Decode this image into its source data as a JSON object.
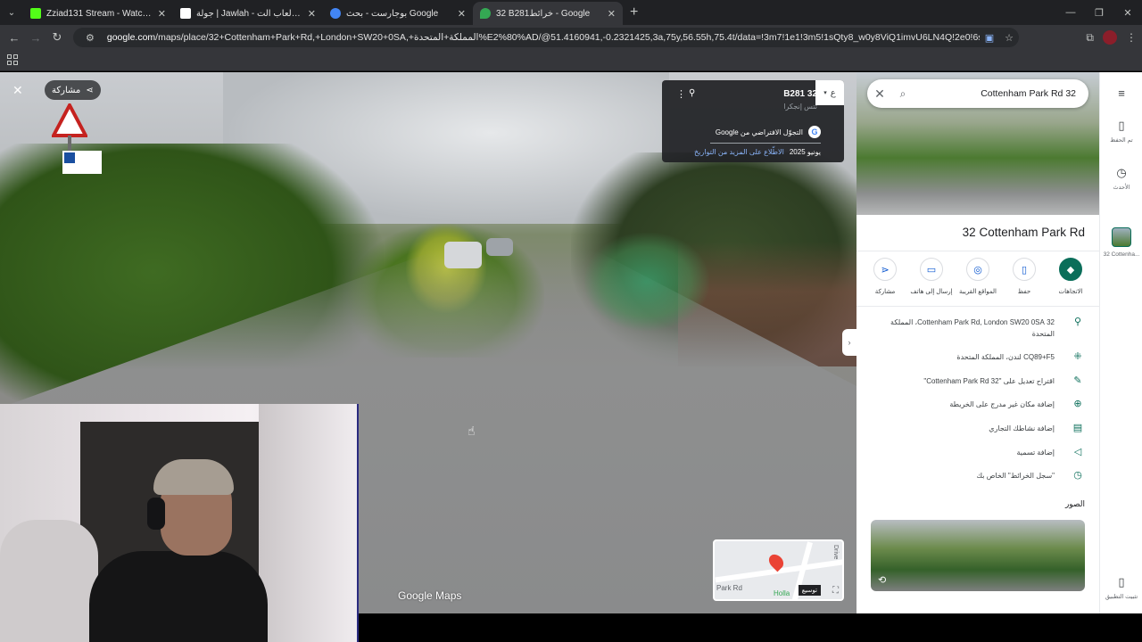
{
  "browser": {
    "tabs": [
      {
        "title": "Zziad131 Stream - Watch Live o",
        "active": false,
        "favicon_color": "#53fc18"
      },
      {
        "title": "جولة | Jawlah - منصة الألعاب الت",
        "active": false,
        "favicon_color": "#ffffff"
      },
      {
        "title": "بوجارست - بحث Google",
        "active": false,
        "favicon_color": "#4285f4"
      },
      {
        "title": "32 B281خرائط - Google",
        "active": true,
        "favicon_color": "#34a853"
      }
    ],
    "new_tab": "+",
    "url_host": "google.com",
    "url_rest": "/maps/place/32+Cottenham+Park+Rd,+London+SW20+0SA,+المملكة+المتحدة%E2%80%AD/@51.4160941,-0.2321425,3a,75y,56.55h,75.4t/data=!3m7!1e1!3m5!1sQty8_w0y8ViQ1imvU6LN4Q!2e0!6shttps:%2F%2Fstreetviewpixels-pa.googl..."
  },
  "street_view": {
    "share_label": "مشاركة",
    "card": {
      "title": "32 B281",
      "subtitle": "تتس إنجكرا",
      "provider": "التجوّل الافتراضي من Google",
      "date": "يونيو 2025",
      "more_dates": "الاطّلاع على المزيد من التواريخ",
      "tag": "ع"
    },
    "logo": "Google Maps",
    "mini_map": {
      "street_label": "Park Rd",
      "place_label": "Holla",
      "drive_label": "Drive",
      "expand_label": "توسيع"
    }
  },
  "panel": {
    "search_value": "Cottenham Park Rd 32",
    "place_title": "32 Cottenham Park Rd",
    "actions": [
      {
        "label": "الاتجاهات",
        "icon": "directions-icon",
        "glyph": "◆",
        "primary": true
      },
      {
        "label": "حفظ",
        "icon": "bookmark-icon",
        "glyph": "▯",
        "primary": false
      },
      {
        "label": "المواقع القريبة",
        "icon": "nearby-icon",
        "glyph": "◎",
        "primary": false
      },
      {
        "label": "إرسال إلى هاتف",
        "icon": "phone-icon",
        "glyph": "▭",
        "primary": false
      },
      {
        "label": "مشاركة",
        "icon": "share-icon",
        "glyph": "⋖",
        "primary": false
      }
    ],
    "info": [
      {
        "icon": "location-pin-icon",
        "glyph": "⚲",
        "text": "32 Cottenham Park Rd, London SW20 0SA، المملكة المتحدة"
      },
      {
        "icon": "plus-code-icon",
        "glyph": "⁜",
        "text": "CQ89+F5 لندن، المملكة المتحدة"
      },
      {
        "icon": "edit-icon",
        "glyph": "✎",
        "text": "اقتراح تعديل على \"Cottenham Park Rd 32\""
      },
      {
        "icon": "add-place-icon",
        "glyph": "⊕",
        "text": "إضافة مكان غير مدرج على الخريطة"
      },
      {
        "icon": "add-business-icon",
        "glyph": "▤",
        "text": "إضافة نشاطك التجاري"
      },
      {
        "icon": "label-icon",
        "glyph": "◁",
        "text": "إضافة تسمية"
      },
      {
        "icon": "history-icon",
        "glyph": "◷",
        "text": "\"سجل الخرائط\" الخاص بك"
      }
    ],
    "photos_heading": "الصور"
  },
  "rail": {
    "saved_label": "تم الحفظ",
    "recent_label": "الأحدث",
    "recent_place_label": "32 Cottenha...",
    "install_label": "تثبيت التطبيق"
  }
}
